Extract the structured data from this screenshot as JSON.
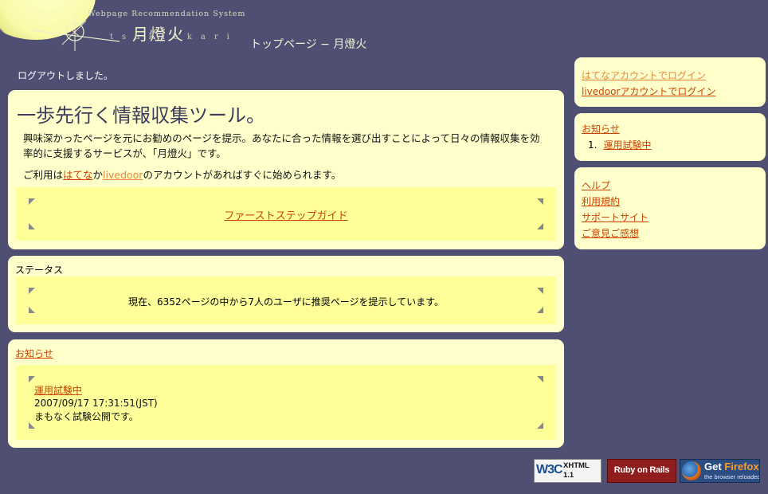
{
  "header": {
    "site_name_en": "Webpage Recommendation System",
    "site_name_kanji": "月燈火",
    "site_name_roman": "tsukiakari",
    "page_title": "トップページ − 月燈火"
  },
  "main": {
    "logout_message": "ログアウトしました。",
    "intro": {
      "heading": "一歩先行く情報収集ツール。",
      "description": "興味深かったページを元にお勧めのページを提示。あなたに合った情報を選び出すことによって日々の情報収集を効率的に支援するサービスが、「月燈火」です。",
      "usage_prefix": "ご利用は",
      "usage_hatena": "はてな",
      "usage_mid": "か",
      "usage_livedoor": "livedoor",
      "usage_suffix": "のアカウントがあればすぐに始められます。",
      "guide_link": "ファーストステップガイド"
    },
    "status": {
      "label": "ステータス",
      "text": "現在、6352ページの中から7人のユーザに推奨ページを提示しています。"
    },
    "news": {
      "title": "お知らせ",
      "items": [
        {
          "title": "運用試験中",
          "date": "2007/09/17 17:31:51(JST)",
          "body": "まもなく試験公開です。"
        }
      ]
    }
  },
  "sidebar": {
    "login": {
      "hatena": "はてなアカウントでログイン",
      "livedoor": "livedoorアカウントでログイン"
    },
    "news": {
      "title": "お知らせ",
      "items": [
        {
          "number": "1.",
          "label": "運用試験中"
        }
      ]
    },
    "help": {
      "links": [
        "ヘルプ",
        "利用規約",
        "サポートサイト",
        "ご意見ご感想"
      ]
    }
  },
  "badges": {
    "xhtml": {
      "w3c": "W3C",
      "line1": "XHTML",
      "line2": "1.1"
    },
    "rails": {
      "label": "Ruby on Rails"
    },
    "firefox": {
      "get": "Get",
      "brand": "Firefox",
      "tagline": "the browser reloaded"
    }
  },
  "colors": {
    "background": "#4e4f72",
    "panel": "#ffffcc",
    "panel_inner": "#ffff99",
    "link": "#cc4400",
    "link_visited": "#e08a3a",
    "heading": "#3b3b5a"
  }
}
